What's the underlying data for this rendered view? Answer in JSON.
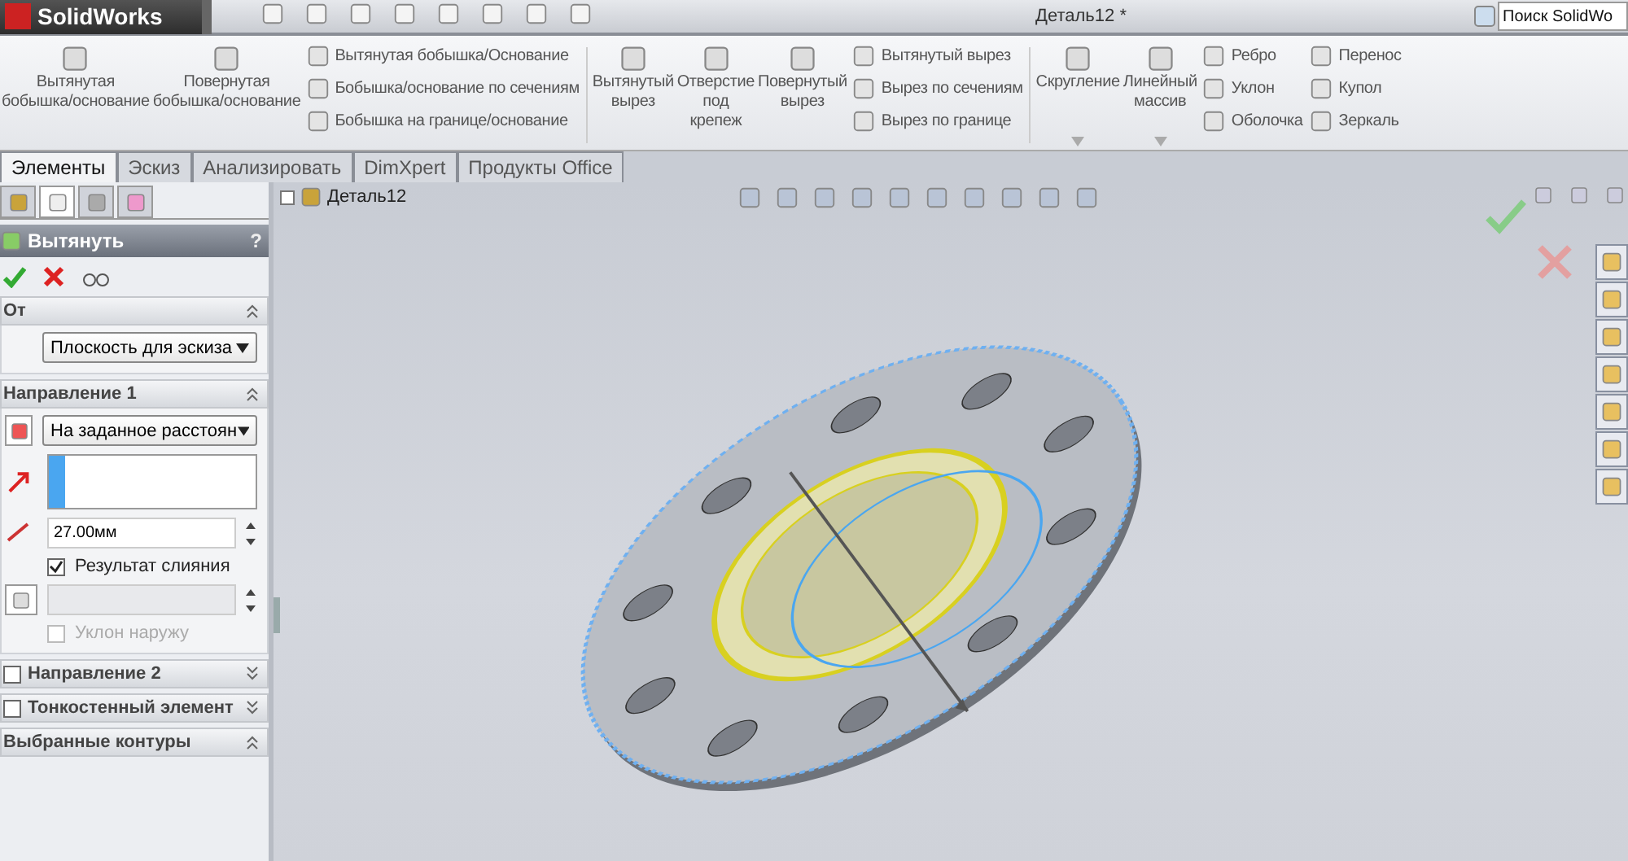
{
  "app": {
    "logo_text": "SolidWorks",
    "document_title": "Деталь12 *",
    "search": {
      "placeholder": "Поиск SolidWo"
    }
  },
  "ribbon": [
    {
      "kind": "big",
      "lines": [
        "Вытянутая",
        "бобышка/основание"
      ]
    },
    {
      "kind": "big",
      "lines": [
        "Повернутая",
        "бобышка/основание"
      ]
    },
    {
      "kind": "stack",
      "items": [
        "Вытянутая бобышка/Основание",
        "Бобышка/основание по сечениям",
        "Бобышка на границе/основание"
      ]
    },
    {
      "kind": "sep"
    },
    {
      "kind": "big",
      "lines": [
        "Вытянутый",
        "вырез"
      ]
    },
    {
      "kind": "big",
      "lines": [
        "Отверстие",
        "под",
        "крепеж"
      ]
    },
    {
      "kind": "big",
      "lines": [
        "Повернутый",
        "вырез"
      ]
    },
    {
      "kind": "stack",
      "items": [
        "Вытянутый вырез",
        "Вырез по сечениям",
        "Вырез по границе"
      ]
    },
    {
      "kind": "sep"
    },
    {
      "kind": "big",
      "lines": [
        "Скругление"
      ],
      "dropdown": true
    },
    {
      "kind": "big",
      "lines": [
        "Линейный",
        "массив"
      ],
      "dropdown": true
    },
    {
      "kind": "stack",
      "items": [
        "Ребро",
        "Уклон",
        "Оболочка"
      ]
    },
    {
      "kind": "stack",
      "items": [
        "Перенос",
        "Купол",
        "Зеркаль"
      ]
    }
  ],
  "tabs": [
    {
      "label": "Элементы",
      "selected": true
    },
    {
      "label": "Эскиз",
      "selected": false
    },
    {
      "label": "Анализировать",
      "selected": false
    },
    {
      "label": "DimXpert",
      "selected": false
    },
    {
      "label": "Продукты Office",
      "selected": false
    }
  ],
  "panel_tabs": [
    {
      "selected": false
    },
    {
      "selected": true
    },
    {
      "selected": false
    },
    {
      "selected": false
    }
  ],
  "property_manager": {
    "title": "Вытянуть",
    "help": "?",
    "sections": [
      {
        "kind": "from",
        "title": "От",
        "expanded": true,
        "dropdown": "Плоскость для эскиза"
      },
      {
        "kind": "direction",
        "title": "Направление 1",
        "expanded": true,
        "end_condition": "На заданное расстоян",
        "distance": "27.00мм",
        "merge": {
          "label": "Результат слияния",
          "checked": true
        },
        "draft_outward": {
          "label": "Уклон наружу",
          "checked": false,
          "disabled": true
        }
      },
      {
        "kind": "optional",
        "title": "Направление 2",
        "expanded": false,
        "checked": false
      },
      {
        "kind": "optional",
        "title": "Тонкостенный элемент",
        "expanded": false,
        "checked": false
      },
      {
        "kind": "plain",
        "title": "Выбранные контуры",
        "expanded": true
      }
    ]
  },
  "tree": {
    "root": "Деталь12"
  }
}
